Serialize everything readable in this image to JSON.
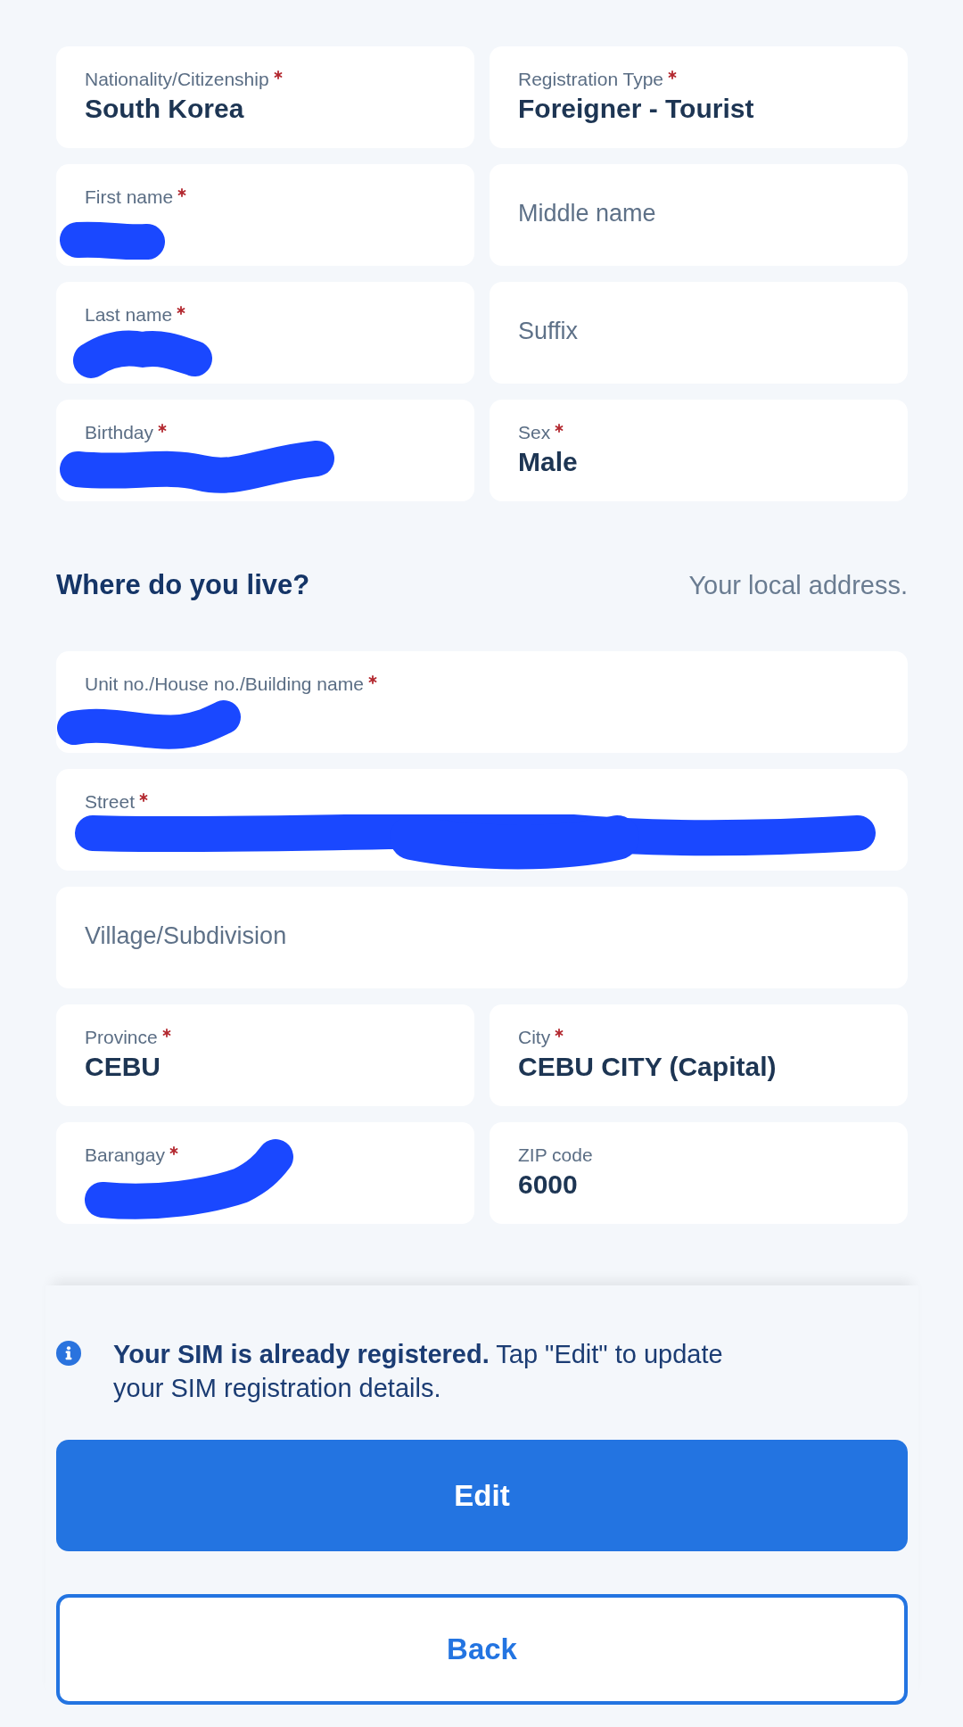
{
  "personal_details": {
    "rows": [
      {
        "fields": [
          {
            "label": "Nationality/Citizenship",
            "required": true,
            "value": "South Korea",
            "redacted": false
          },
          {
            "label": "Registration Type",
            "required": true,
            "value": "Foreigner - Tourist",
            "redacted": false
          }
        ]
      },
      {
        "fields": [
          {
            "label": "First name",
            "required": true,
            "redacted": true
          },
          {
            "placeholder": "Middle name",
            "redacted": false
          }
        ]
      },
      {
        "fields": [
          {
            "label": "Last name",
            "required": true,
            "redacted": true
          },
          {
            "placeholder": "Suffix",
            "redacted": false
          }
        ]
      },
      {
        "fields": [
          {
            "label": "Birthday",
            "required": true,
            "redacted": true
          },
          {
            "label": "Sex",
            "required": true,
            "value": "Male",
            "redacted": false
          }
        ]
      }
    ]
  },
  "address": {
    "title": "Where do you live?",
    "hint": "Your local address.",
    "rows": [
      {
        "fields": [
          {
            "label": "Unit no./House no./Building name",
            "required": true,
            "redacted": true
          }
        ]
      },
      {
        "fields": [
          {
            "label": "Street",
            "required": true,
            "redacted": true
          }
        ]
      },
      {
        "fields": [
          {
            "placeholder": "Village/Subdivision",
            "redacted": false
          }
        ]
      },
      {
        "fields": [
          {
            "label": "Province",
            "required": true,
            "value": "CEBU",
            "redacted": false
          },
          {
            "label": "City",
            "required": true,
            "value": "CEBU CITY (Capital)",
            "redacted": false
          }
        ]
      },
      {
        "fields": [
          {
            "label": "Barangay",
            "required": true,
            "redacted": true
          },
          {
            "label": "ZIP code",
            "required": false,
            "value": "6000",
            "redacted": false
          }
        ]
      }
    ]
  },
  "notice": {
    "text": "**Your SIM is already registered.** Tap \"Edit\" to update your SIM registration details."
  },
  "buttons": [
    {
      "label": "Edit",
      "kind": "primary"
    },
    {
      "label": "Back",
      "kind": "secondary"
    }
  ]
}
